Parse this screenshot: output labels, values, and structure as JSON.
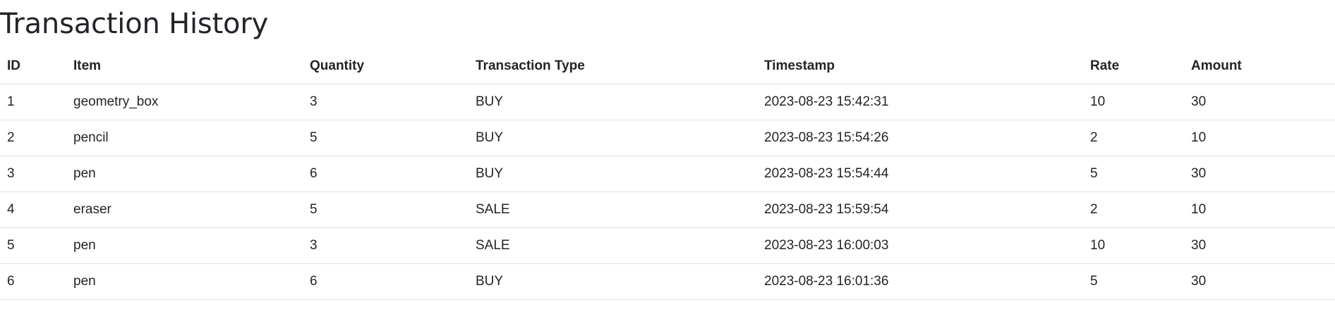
{
  "page": {
    "title": "Transaction History"
  },
  "table": {
    "columns": [
      "ID",
      "Item",
      "Quantity",
      "Transaction Type",
      "Timestamp",
      "Rate",
      "Amount"
    ],
    "rows": [
      [
        "1",
        "geometry_box",
        "3",
        "BUY",
        "2023-08-23 15:42:31",
        "10",
        "30"
      ],
      [
        "2",
        "pencil",
        "5",
        "BUY",
        "2023-08-23 15:54:26",
        "2",
        "10"
      ],
      [
        "3",
        "pen",
        "6",
        "BUY",
        "2023-08-23 15:54:44",
        "5",
        "30"
      ],
      [
        "4",
        "eraser",
        "5",
        "SALE",
        "2023-08-23 15:59:54",
        "2",
        "10"
      ],
      [
        "5",
        "pen",
        "3",
        "SALE",
        "2023-08-23 16:00:03",
        "10",
        "30"
      ],
      [
        "6",
        "pen",
        "6",
        "BUY",
        "2023-08-23 16:01:36",
        "5",
        "30"
      ]
    ]
  },
  "colors": {
    "text": "#212529",
    "border": "#dee2e6",
    "background": "#ffffff"
  }
}
